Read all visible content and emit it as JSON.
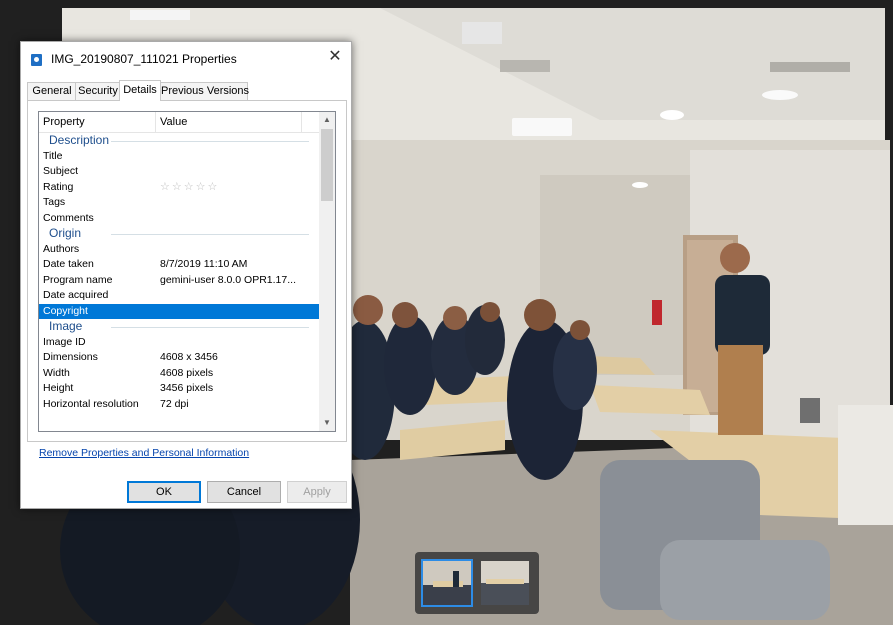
{
  "dialog": {
    "title": "IMG_20190807_111021 Properties",
    "close_label": "✕",
    "tabs": [
      {
        "label": "General"
      },
      {
        "label": "Security"
      },
      {
        "label": "Details"
      },
      {
        "label": "Previous Versions"
      }
    ],
    "active_tab": "Details",
    "columns": {
      "property": "Property",
      "value": "Value"
    },
    "rows": [
      {
        "type": "group",
        "label": "Description"
      },
      {
        "label": "Title",
        "value": ""
      },
      {
        "label": "Subject",
        "value": ""
      },
      {
        "label": "Rating",
        "value": "☆☆☆☆☆",
        "rating": 0
      },
      {
        "label": "Tags",
        "value": ""
      },
      {
        "label": "Comments",
        "value": ""
      },
      {
        "type": "group",
        "label": "Origin"
      },
      {
        "label": "Authors",
        "value": ""
      },
      {
        "label": "Date taken",
        "value": "8/7/2019 11:10 AM"
      },
      {
        "label": "Program name",
        "value": "gemini-user 8.0.0 OPR1.17..."
      },
      {
        "label": "Date acquired",
        "value": ""
      },
      {
        "label": "Copyright",
        "value": "",
        "selected": true
      },
      {
        "type": "group",
        "label": "Image"
      },
      {
        "label": "Image ID",
        "value": ""
      },
      {
        "label": "Dimensions",
        "value": "4608 x 3456"
      },
      {
        "label": "Width",
        "value": "4608 pixels"
      },
      {
        "label": "Height",
        "value": "3456 pixels"
      },
      {
        "label": "Horizontal resolution",
        "value": "72 dpi"
      }
    ],
    "remove_link": "Remove Properties and Personal Information",
    "buttons": {
      "ok": "OK",
      "cancel": "Cancel",
      "apply": "Apply"
    },
    "accent": "#0078d7"
  },
  "filmstrip": {
    "thumbnails": [
      "classroom-photo-1",
      "classroom-photo-2"
    ],
    "active_index": 0
  }
}
